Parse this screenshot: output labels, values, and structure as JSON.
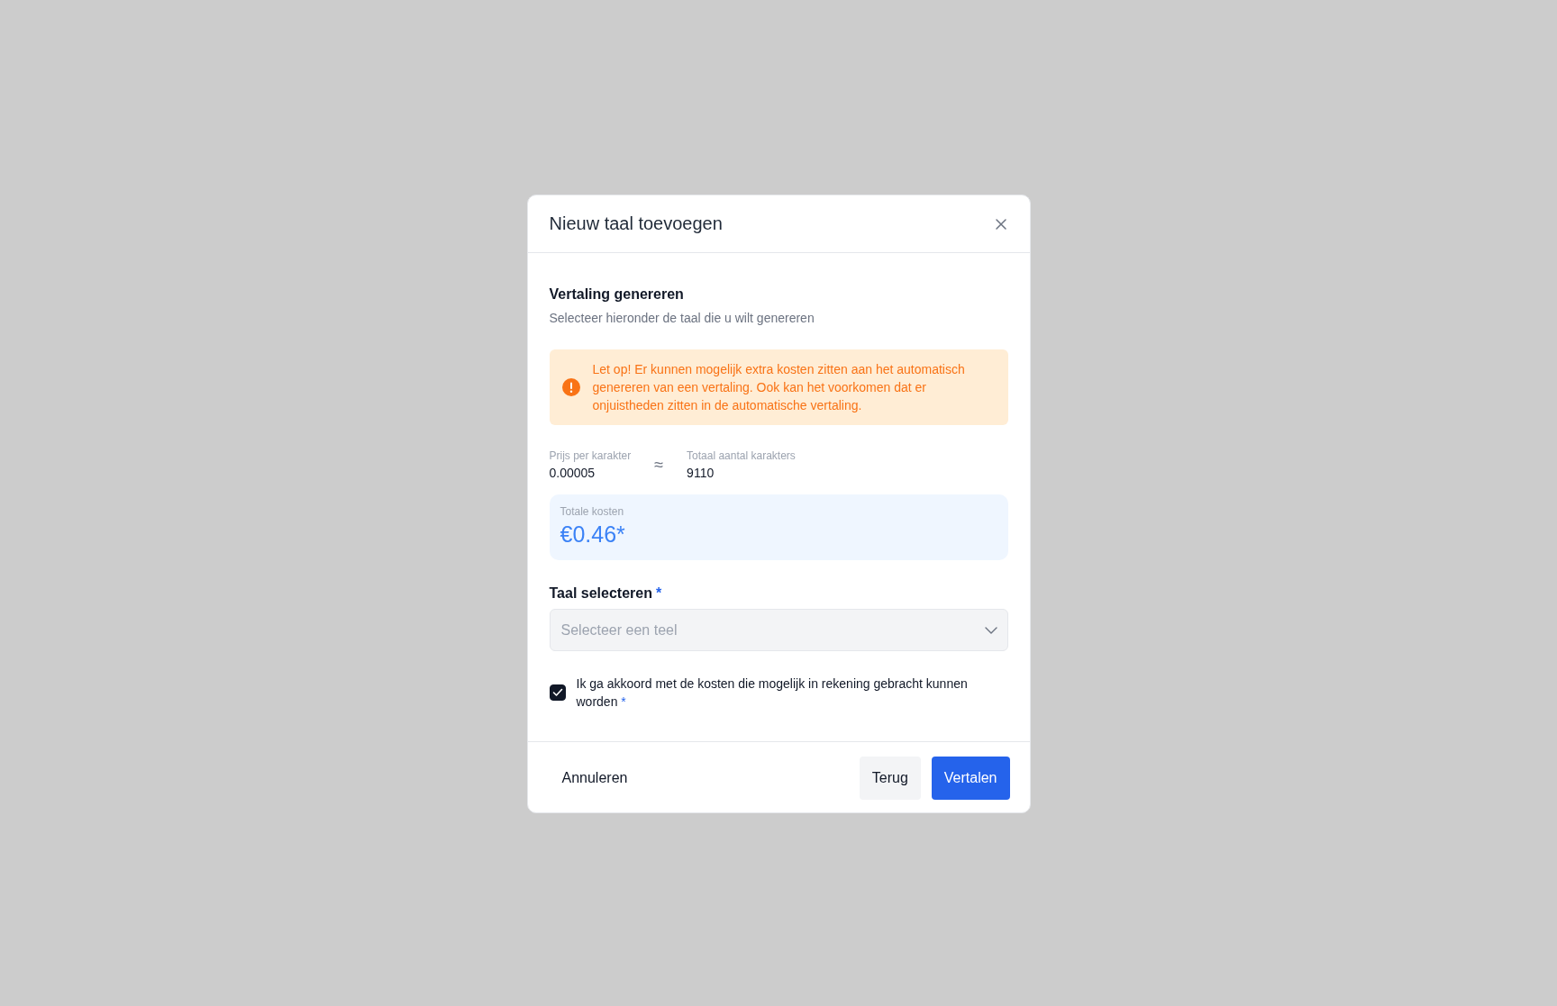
{
  "dialog": {
    "title": "Nieuw taal toevoegen",
    "section_title": "Vertaling genereren",
    "section_subtitle": "Selecteer hieronder de taal die u wilt genereren",
    "warning": "Let op! Er kunnen mogelijk extra kosten zitten aan het automatisch genereren van een vertaling. Ook kan het voorkomen dat er onjuistheden zitten in de automatische vertaling.",
    "stats": [
      {
        "label": "Prijs per karakter",
        "value": "0.00005"
      },
      {
        "label": "Totaal aantal karakters",
        "value": "9110"
      }
    ],
    "approx_sign": "≈",
    "total": {
      "label": "Totale kosten",
      "value": "€0.46*"
    },
    "language_select": {
      "label": "Taal selecteren",
      "required_mark": "*",
      "placeholder": "Selecteer een teel"
    },
    "agreement": {
      "text": "Ik ga akkoord met de kosten die mogelijk in rekening gebracht kunnen worden",
      "required_mark": "*",
      "checked": true
    },
    "buttons": [
      {
        "label": "Annuleren",
        "kind": "text"
      },
      {
        "label": "Terug",
        "kind": "secondary"
      },
      {
        "label": "Vertalen",
        "kind": "primary"
      }
    ]
  }
}
